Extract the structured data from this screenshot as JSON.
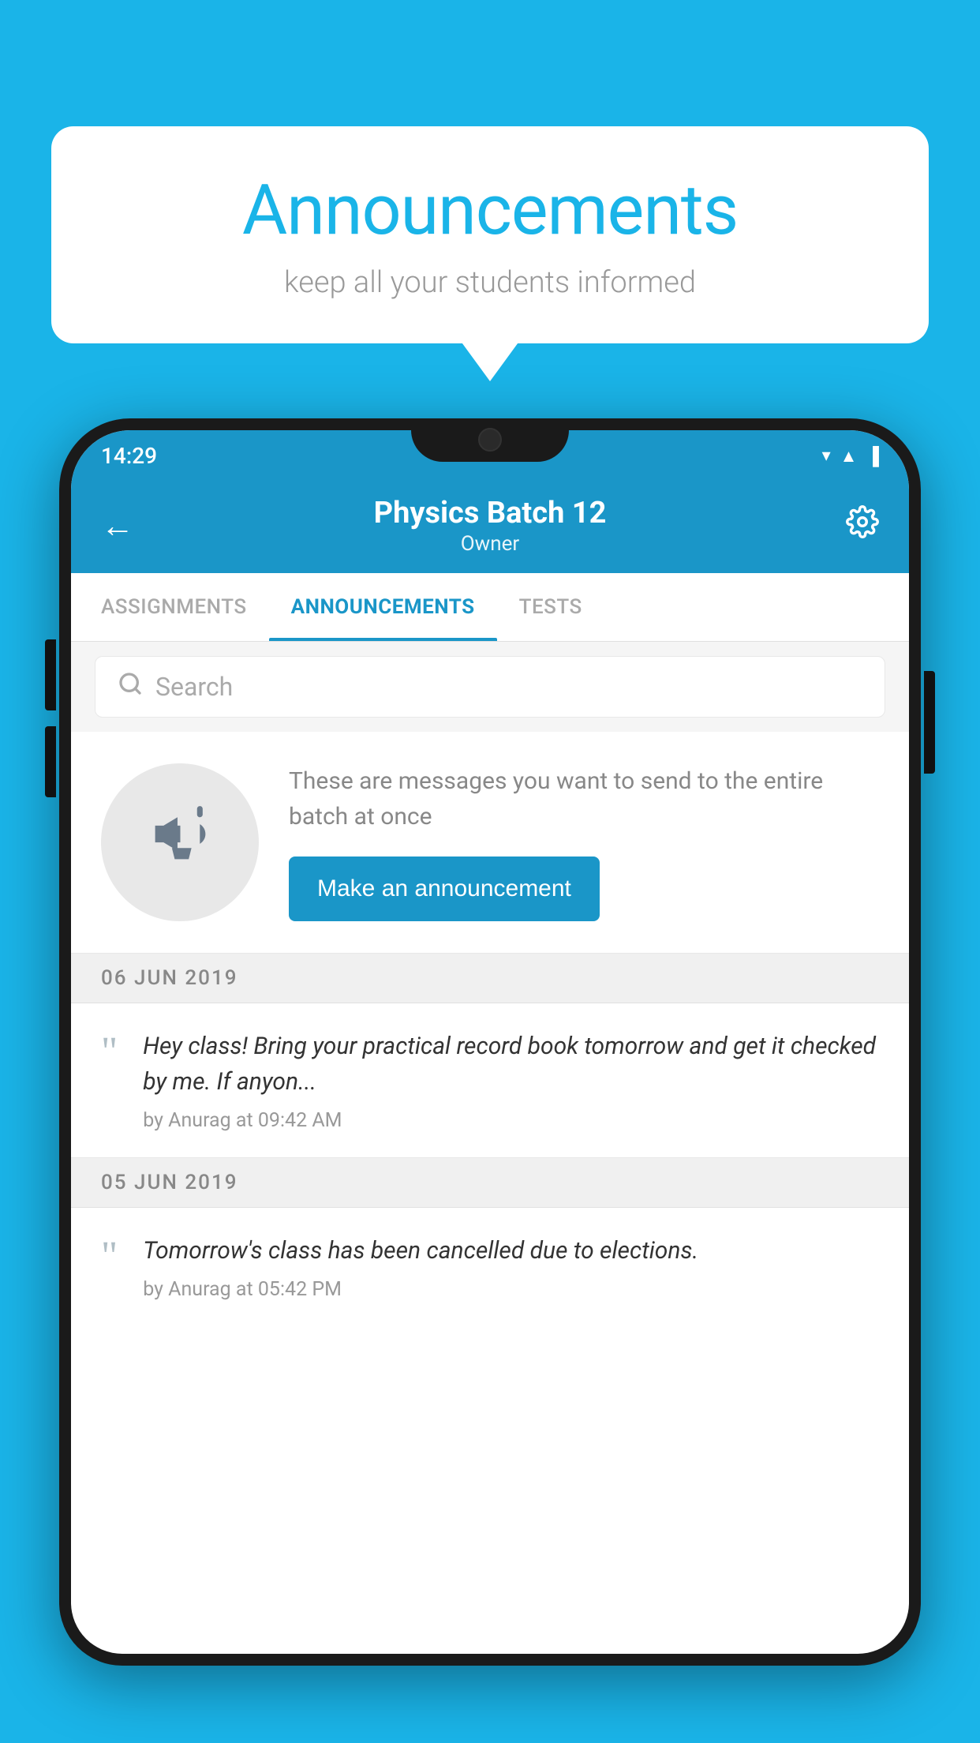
{
  "page": {
    "background_color": "#1ab4e8"
  },
  "speech_bubble": {
    "title": "Announcements",
    "subtitle": "keep all your students informed"
  },
  "phone": {
    "status_bar": {
      "time": "14:29",
      "icons": [
        "wifi",
        "signal",
        "battery"
      ]
    },
    "header": {
      "title": "Physics Batch 12",
      "subtitle": "Owner",
      "back_label": "←",
      "settings_label": "⚙"
    },
    "tabs": [
      {
        "label": "ASSIGNMENTS",
        "active": false
      },
      {
        "label": "ANNOUNCEMENTS",
        "active": true
      },
      {
        "label": "TESTS",
        "active": false
      }
    ],
    "search": {
      "placeholder": "Search"
    },
    "announcement_prompt": {
      "description_text": "These are messages you want to send to the entire batch at once",
      "button_label": "Make an announcement"
    },
    "date_sections": [
      {
        "date": "06  JUN  2019",
        "announcements": [
          {
            "text": "Hey class! Bring your practical record book tomorrow and get it checked by me. If anyon...",
            "meta": "by Anurag at 09:42 AM"
          }
        ]
      },
      {
        "date": "05  JUN  2019",
        "announcements": [
          {
            "text": "Tomorrow's class has been cancelled due to elections.",
            "meta": "by Anurag at 05:42 PM"
          }
        ]
      }
    ]
  }
}
